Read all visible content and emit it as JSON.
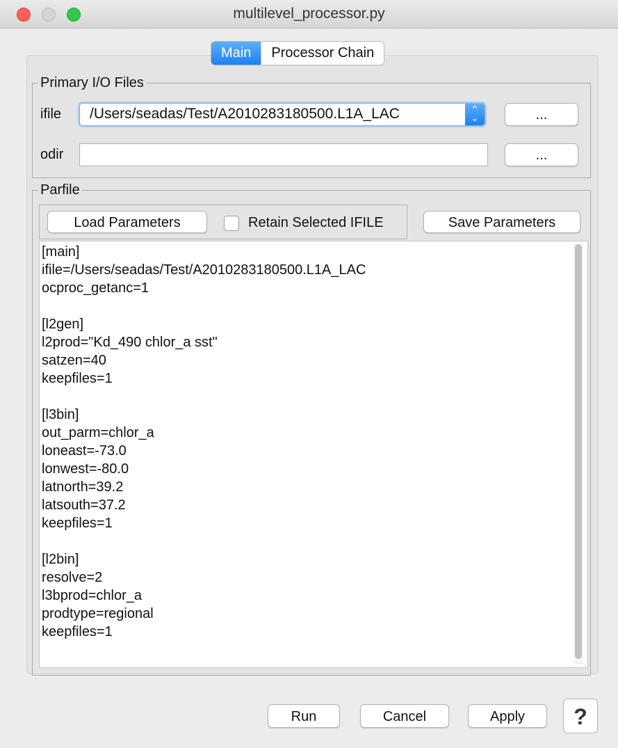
{
  "window": {
    "title": "multilevel_processor.py"
  },
  "tabs": [
    {
      "label": "Main",
      "active": true
    },
    {
      "label": "Processor Chain",
      "active": false
    }
  ],
  "io_group": {
    "legend": "Primary I/O Files",
    "ifile_label": "ifile",
    "ifile_value": "/Users/seadas/Test/A2010283180500.L1A_LAC",
    "odir_label": "odir",
    "odir_value": "",
    "browse_label": "..."
  },
  "parfile": {
    "legend": "Parfile",
    "load_label": "Load Parameters",
    "retain_label": "Retain Selected IFILE",
    "retain_checked": false,
    "save_label": "Save Parameters",
    "text": "[main]\nifile=/Users/seadas/Test/A2010283180500.L1A_LAC\nocproc_getanc=1\n\n[l2gen]\nl2prod=\"Kd_490 chlor_a sst\"\nsatzen=40\nkeepfiles=1\n\n[l3bin]\nout_parm=chlor_a\nloneast=-73.0\nlonwest=-80.0\nlatnorth=39.2\nlatsouth=37.2\nkeepfiles=1\n\n[l2bin]\nresolve=2\nl3bprod=chlor_a\nprodtype=regional\nkeepfiles=1"
  },
  "footer": {
    "run_label": "Run",
    "cancel_label": "Cancel",
    "apply_label": "Apply",
    "help_label": "?"
  },
  "colors": {
    "accent": "#1b82f0",
    "close": "#fc5f57",
    "maximize": "#34c84a"
  }
}
